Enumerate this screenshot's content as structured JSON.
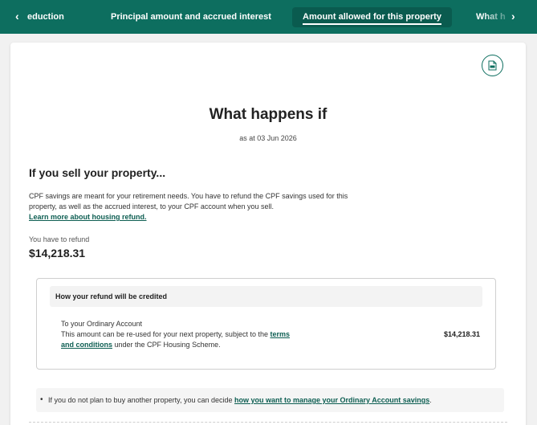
{
  "tabs": {
    "prev_icon": "chevron-left-icon",
    "next_icon": "chevron-right-icon",
    "items": [
      {
        "label": "eduction"
      },
      {
        "label": "Principal amount and accrued interest"
      },
      {
        "label": "Amount allowed for this property"
      },
      {
        "label": "What h"
      }
    ]
  },
  "pdf_icon": "pdf-download-icon",
  "title": "What happens if",
  "as_at": "as at 03 Jun 2026",
  "section": {
    "heading": "If you sell your property...",
    "para_text": "CPF savings are meant for your retirement needs. You have to refund the CPF savings used for this property, as well as the accrued interest, to your CPF account when you sell.",
    "link": "Learn more about housing refund.",
    "refund_label": "You have to refund",
    "refund_value": "$14,218.31"
  },
  "credit_box": {
    "heading": "How your refund will be credited",
    "account_title": "To your Ordinary Account",
    "desc_before": "This amount can be re-used for your next property, subject to the",
    "desc_link": "terms and conditions",
    "desc_after": "under the CPF Housing Scheme.",
    "amount": "$14,218.31"
  },
  "note": {
    "text_before": "If you do not plan to buy another property, you can decide",
    "link": "how you want to manage your Ordinary Account savings",
    "text_after": "."
  },
  "colors": {
    "brand": "#0d6e5f",
    "link": "#0d5e52"
  }
}
